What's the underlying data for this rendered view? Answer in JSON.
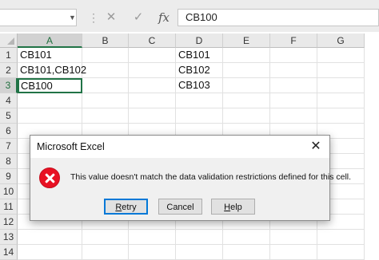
{
  "formula_bar": {
    "name_box_value": "",
    "cancel_glyph": "✕",
    "enter_glyph": "✓",
    "fx_label": "fx",
    "formula_value": "CB100"
  },
  "columns": [
    "A",
    "B",
    "C",
    "D",
    "E",
    "F",
    "G"
  ],
  "rows": [
    "1",
    "2",
    "3",
    "4",
    "5",
    "6",
    "7",
    "8",
    "9",
    "10",
    "11",
    "12",
    "13",
    "14"
  ],
  "cells": {
    "A1": "CB101",
    "A2": "CB101,CB102",
    "A3": "CB100",
    "D1": "CB101",
    "D2": "CB102",
    "D3": "CB103"
  },
  "active_cell": "A3",
  "dialog": {
    "title": "Microsoft Excel",
    "close_glyph": "✕",
    "icon": "error-icon",
    "message": "This value doesn't match the data validation restrictions defined for this cell.",
    "buttons": {
      "retry": "Retry",
      "cancel": "Cancel",
      "help": "Help"
    }
  },
  "colors": {
    "accent": "#217346",
    "error": "#e81123",
    "default_button_border": "#0078d7"
  }
}
